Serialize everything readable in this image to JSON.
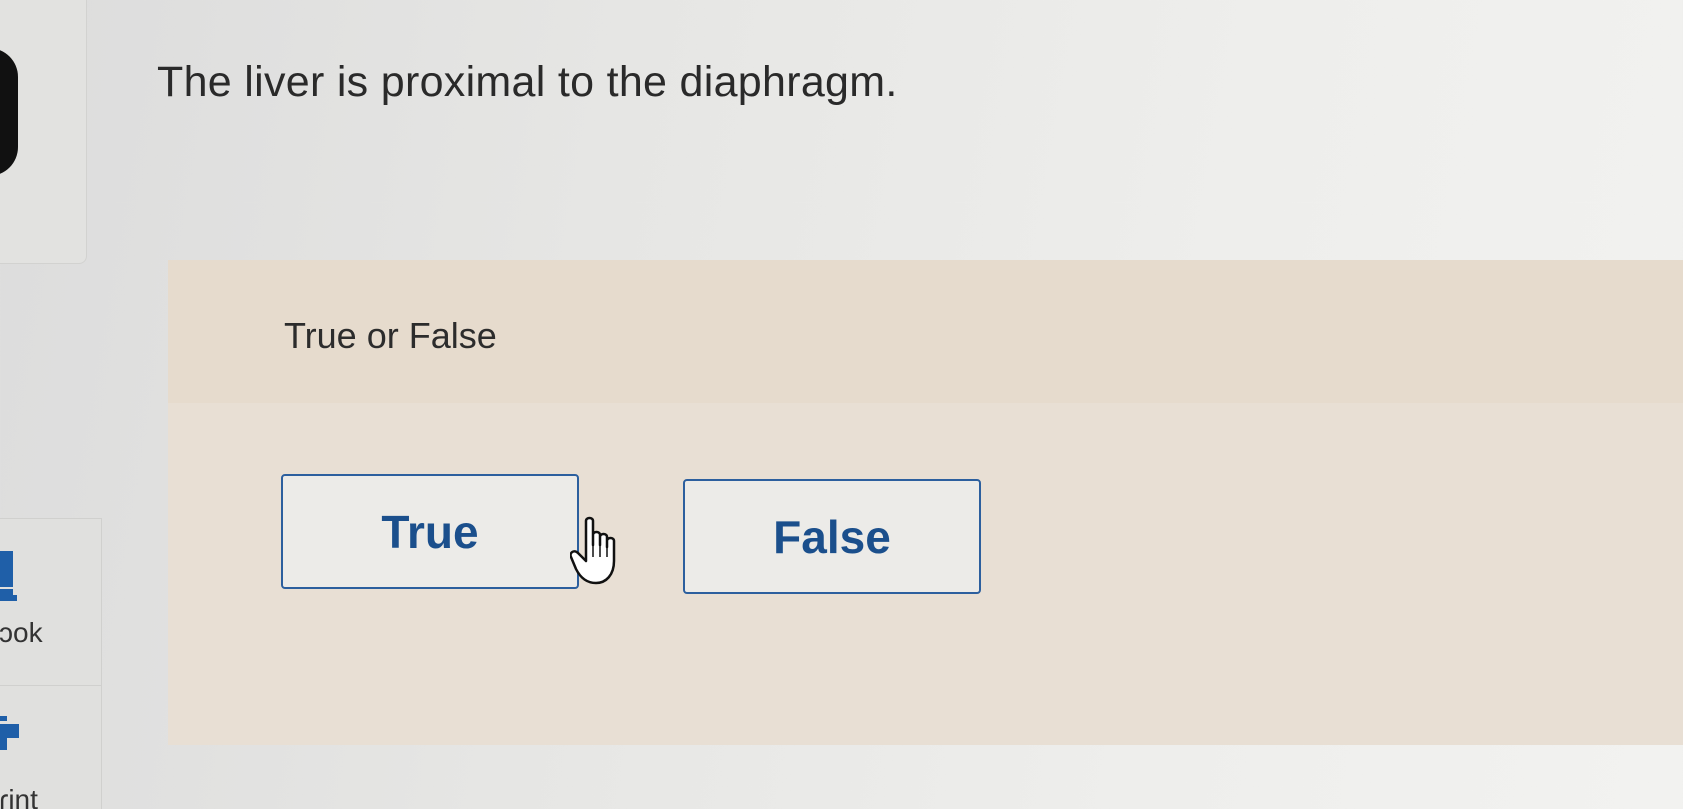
{
  "question": {
    "text": "The liver is proximal to the diaphragm."
  },
  "answer_panel": {
    "prompt": "True or False",
    "choices": [
      {
        "label": "True"
      },
      {
        "label": "False"
      }
    ]
  },
  "sidebar": {
    "tools": [
      {
        "label": "ɔok",
        "icon": "ebook-icon"
      },
      {
        "label": "ɾint",
        "icon": "print-icon"
      }
    ]
  },
  "colors": {
    "choice_text": "#1b4f8c",
    "choice_border": "#2c5f9e",
    "panel_background": "#e8dfd4"
  }
}
